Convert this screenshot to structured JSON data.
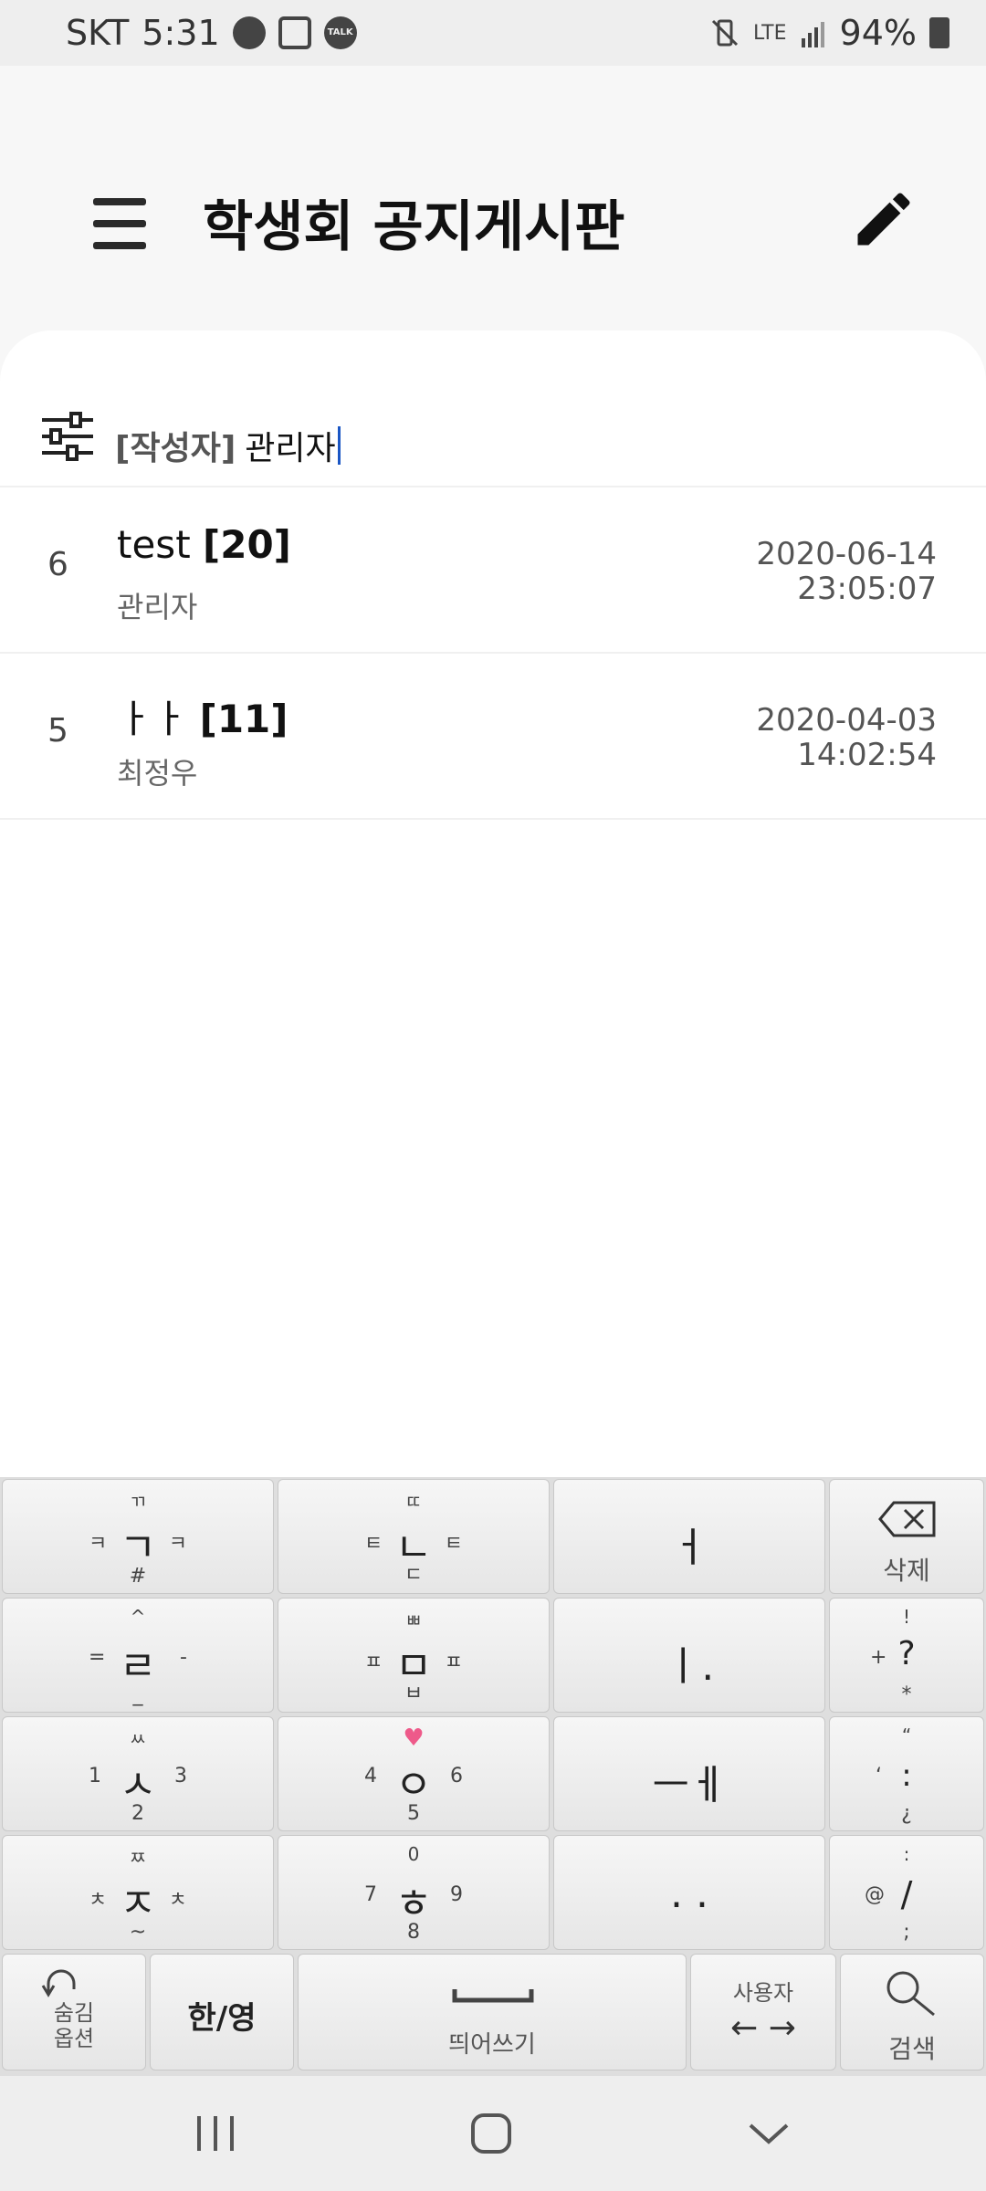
{
  "status_bar": {
    "carrier": "SKT",
    "time": "5:31",
    "network": "LTE",
    "battery": "94%",
    "icons": [
      "bubble-icon",
      "gallery-icon",
      "kakaotalk-icon",
      "vibrate-mute-icon",
      "lte-icon",
      "signal-icon",
      "battery-icon"
    ],
    "talk_label": "TALK"
  },
  "header": {
    "title": "학생회 공지게시판"
  },
  "search": {
    "prefix": "[작성자]",
    "value": "관리자"
  },
  "posts": [
    {
      "number": "6",
      "title": "test",
      "comment_count": "[20]",
      "author": "관리자",
      "date": "2020-06-14",
      "time": "23:05:07"
    },
    {
      "number": "5",
      "title": "ㅏㅏ",
      "comment_count": "[11]",
      "author": "최정우",
      "date": "2020-04-03",
      "time": "14:02:54"
    }
  ],
  "keyboard": {
    "row1": [
      {
        "main": "ㄱ",
        "top": "ㄲ",
        "left": "ㅋ",
        "right": "ㅋ",
        "bottom": "#"
      },
      {
        "main": "ㄴ",
        "top": "ㄸ",
        "left": "ㅌ",
        "right": "ㅌ",
        "bottom": "ㄷ"
      },
      {
        "main": "ㅓ"
      },
      {
        "label": "삭제"
      }
    ],
    "row2": [
      {
        "main": "ㄹ",
        "top": "^",
        "left": "=",
        "right": "-",
        "bottom": "_"
      },
      {
        "main": "ㅁ",
        "top": "ㅃ",
        "left": "ㅍ",
        "right": "ㅍ",
        "bottom": "ㅂ"
      },
      {
        "main": "ㅣ."
      },
      {
        "main": "?",
        "top": "!",
        "left": "+",
        "bottom": "*"
      }
    ],
    "row3": [
      {
        "main": "ㅅ",
        "top": "ㅆ",
        "left": "1",
        "right": "3",
        "bottom": "2"
      },
      {
        "main": "ㅇ",
        "top": "♥",
        "left": "4",
        "right": "6",
        "bottom": "5"
      },
      {
        "main": "ㅡㅔ"
      },
      {
        "main": ":",
        "top": "“",
        "left": "‘",
        "bottom": "¿"
      }
    ],
    "row4": [
      {
        "main": "ㅈ",
        "top": "ㅉ",
        "left": "ㅊ",
        "right": "ㅊ",
        "bottom": "~"
      },
      {
        "main": "ㅎ",
        "top": "0",
        "left": "7",
        "right": "9",
        "bottom": "8"
      },
      {
        "main": ". ."
      },
      {
        "main": "/",
        "top": ":",
        "left": "@",
        "bottom": ";"
      }
    ],
    "row5": {
      "options_top": "숨김",
      "options_bottom": "옵션",
      "lang": "한/영",
      "space": "띄어쓰기",
      "user_top": "사용자",
      "user_bottom": "← →",
      "search": "검색"
    }
  },
  "nav_bar": {
    "icons": [
      "recents-icon",
      "home-icon",
      "back-icon"
    ]
  }
}
